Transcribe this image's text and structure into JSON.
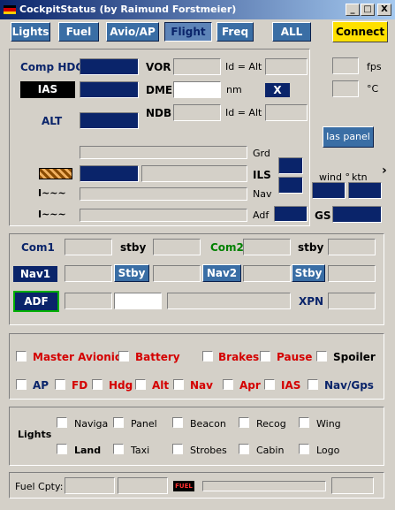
{
  "window": {
    "title": "CockpitStatus (by Raimund Forstmeier)",
    "min": "_",
    "max": "□",
    "close": "X"
  },
  "toolbar": {
    "lights": "Lights",
    "fuel": "Fuel",
    "avio_ap": "Avio/AP",
    "flight": "Flight",
    "freq": "Freq",
    "all": "ALL",
    "connect": "Connect"
  },
  "flight": {
    "comp_hdg": "Comp HDG",
    "ias": "IAS",
    "alt": "ALT",
    "vor": "VOR",
    "dme": "DME",
    "ndb": "NDB",
    "id_alt_1": "Id = Alt",
    "nm": "nm",
    "id_alt_2": "Id = Alt",
    "x_mark": "X",
    "fps": "fps",
    "deg_c": "°C",
    "ias_panel": "Ias panel",
    "grd": "Grd",
    "ils": "ILS",
    "nav": "Nav",
    "adf": "Adf",
    "ind1": "I~~~",
    "ind2": "I~~~",
    "wind": "wind °",
    "ktn": "ktn",
    "gs": "GS",
    "arrow": "›"
  },
  "freq": {
    "com1": "Com1",
    "stby1": "stby",
    "com2": "Com2",
    "stby2": "stby",
    "nav1": "Nav1",
    "stby_btn1": "Stby",
    "nav2": "Nav2",
    "stby_btn2": "Stby",
    "adf": "ADF",
    "xpn": "XPN"
  },
  "avionics": {
    "master_avionic": "Master Avionic",
    "battery": "Battery",
    "brakes": "Brakes",
    "pause": "Pause",
    "spoiler": "Spoiler",
    "ap": "AP",
    "fd": "FD",
    "hdg": "Hdg",
    "alt": "Alt",
    "nav": "Nav",
    "apr": "Apr",
    "ias": "IAS",
    "nav_gps": "Nav/Gps"
  },
  "lights": {
    "title": "Lights",
    "naviga": "Naviga",
    "panel": "Panel",
    "beacon": "Beacon",
    "recog": "Recog",
    "wing": "Wing",
    "land": "Land",
    "taxi": "Taxi",
    "strobes": "Strobes",
    "cabin": "Cabin",
    "logo": "Logo"
  },
  "fuel": {
    "label": "Fuel Cpty:",
    "badge": "FUEL"
  }
}
